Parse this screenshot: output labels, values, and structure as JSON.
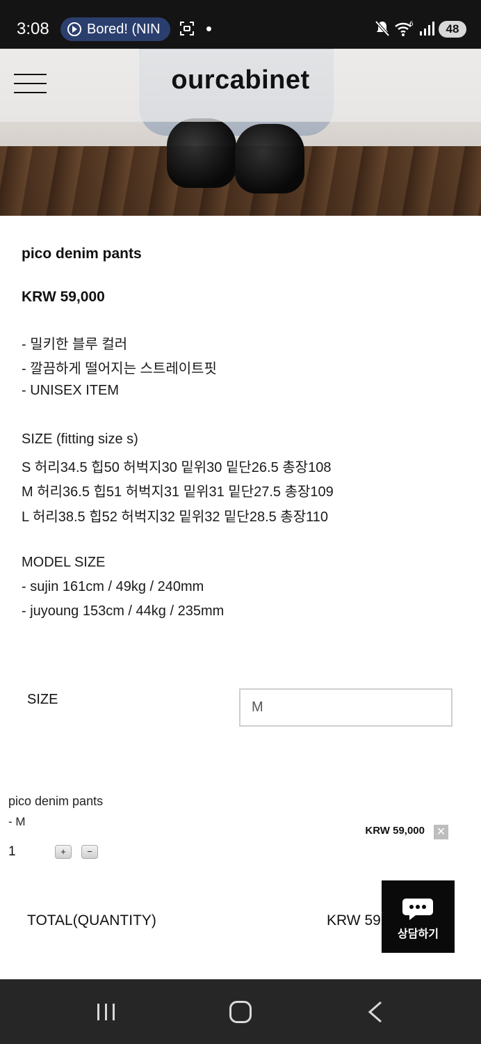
{
  "status_bar": {
    "time": "3:08",
    "media_label": "Bored! (NIN",
    "battery": "48"
  },
  "header": {
    "brand": "ourcabinet"
  },
  "product": {
    "name": "pico denim pants",
    "price": "KRW 59,000",
    "description_lines": [
      "- 밀키한 블루 컬러",
      "- 깔끔하게 떨어지는 스트레이트핏",
      "- UNISEX ITEM",
      "SIZE (fitting size s)",
      "S 허리34.5 힙50 허벅지30 밑위30 밑단26.5 총장108",
      "M 허리36.5 힙51 허벅지31 밑위31 밑단27.5 총장109",
      "L 허리38.5 힙52 허벅지32 밑위32 밑단28.5 총장110",
      "MODEL SIZE",
      "- sujin 161cm / 49kg / 240mm",
      "- juyoung 153cm / 44kg / 235mm"
    ]
  },
  "size_option": {
    "label": "SIZE",
    "selected": "M"
  },
  "selected_item": {
    "name": "pico denim pants",
    "variant": "- M",
    "price": "KRW 59,000",
    "remove": "✕",
    "quantity": "1",
    "plus": "+",
    "minus": "−"
  },
  "total": {
    "label": "TOTAL(QUANTITY)",
    "value": "KRW 59"
  },
  "chat": {
    "label": "상담하기"
  }
}
